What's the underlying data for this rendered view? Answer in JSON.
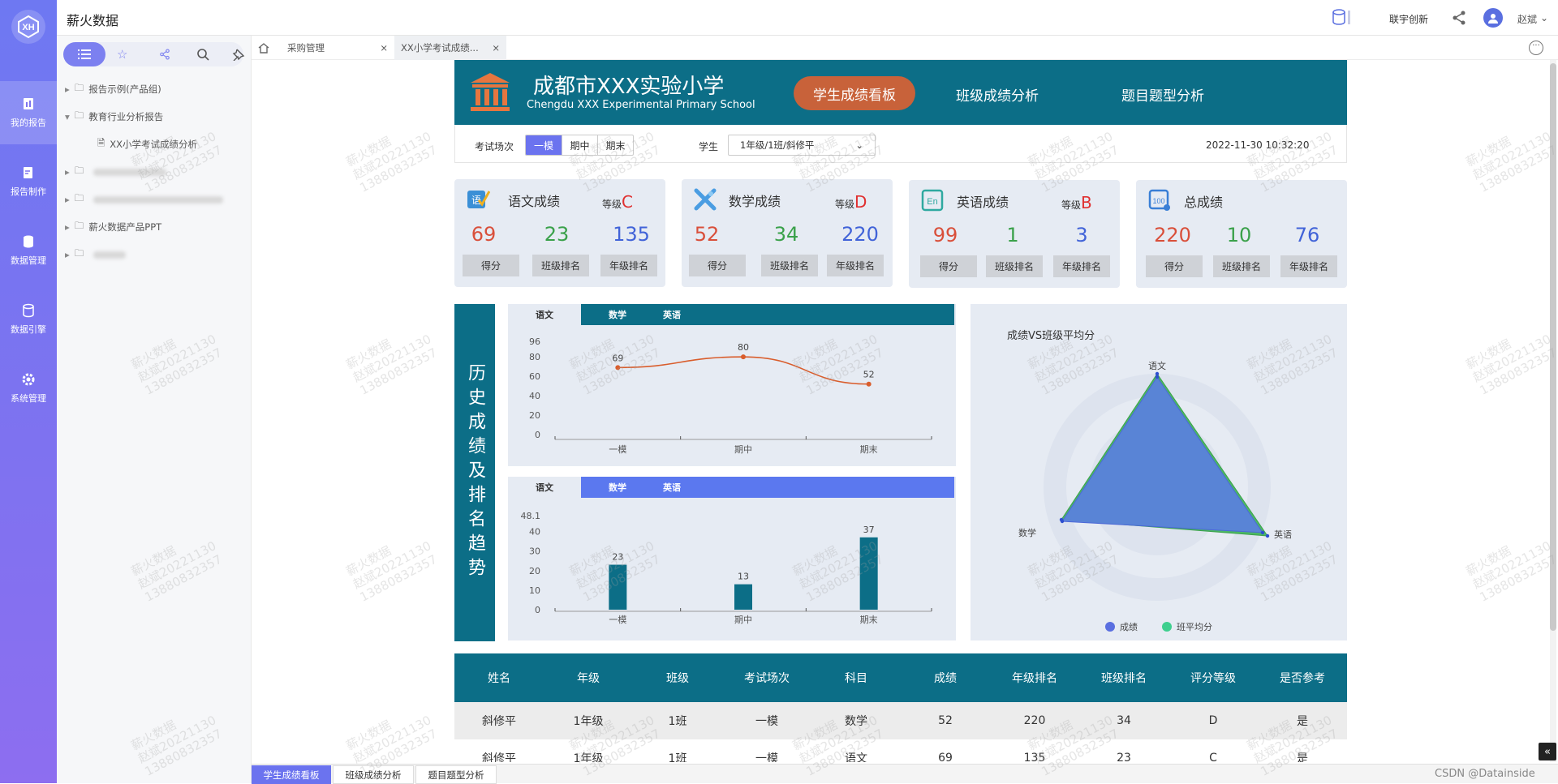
{
  "app": {
    "title": "薪火数据",
    "user": "赵斌",
    "brand_link": "联宇创新"
  },
  "leftnav": [
    {
      "label": "我的报告",
      "icon": "report-icon",
      "active": true
    },
    {
      "label": "报告制作",
      "icon": "edit-icon"
    },
    {
      "label": "数据管理",
      "icon": "database-icon"
    },
    {
      "label": "数据引擎",
      "icon": "engine-icon"
    },
    {
      "label": "系统管理",
      "icon": "gear-icon"
    }
  ],
  "tree": {
    "items": [
      {
        "label": "报告示例(产品组)"
      },
      {
        "label": "教育行业分析报告"
      },
      {
        "label": "XX小学考试成绩分析"
      },
      {
        "label": ""
      },
      {
        "label": ""
      },
      {
        "label": "薪火数据产品PPT"
      },
      {
        "label": ""
      }
    ]
  },
  "tabs": [
    {
      "label": "采购管理"
    },
    {
      "label": "XX小学考试成绩..."
    }
  ],
  "header": {
    "school_cn": "成都市XXX实验小学",
    "school_en": "Chengdu XXX Experimental Primary School",
    "nav": [
      "学生成绩看板",
      "班级成绩分析",
      "题目题型分析"
    ]
  },
  "filters": {
    "exam_label": "考试场次",
    "exam_options": [
      "一模",
      "期中",
      "期末"
    ],
    "student_label": "学生",
    "student_value": "1年级/1班/斜修平",
    "datetime": "2022-11-30 10:32:20"
  },
  "cards": [
    {
      "title": "语文成绩",
      "level_label": "等级",
      "level": "C",
      "score": "69",
      "class_rank": "23",
      "grade_rank": "135",
      "icon": "chinese-icon"
    },
    {
      "title": "数学成绩",
      "level_label": "等级",
      "level": "D",
      "score": "52",
      "class_rank": "34",
      "grade_rank": "220",
      "icon": "math-icon"
    },
    {
      "title": "英语成绩",
      "level_label": "等级",
      "level": "B",
      "score": "99",
      "class_rank": "1",
      "grade_rank": "3",
      "icon": "english-icon"
    },
    {
      "title": "总成绩",
      "level_label": "",
      "level": "",
      "score": "220",
      "class_rank": "10",
      "grade_rank": "76",
      "icon": "total-icon"
    }
  ],
  "card_labels": [
    "得分",
    "班级排名",
    "年级排名"
  ],
  "trend_title": "历史成绩及排名趋势",
  "subject_tabs": [
    "语文",
    "数学",
    "英语"
  ],
  "radar_title": "成绩VS班级平均分",
  "colors": {
    "primary": "#0c6e87",
    "accent": "#c8623a",
    "score": "#5a6fe0",
    "avg": "#4cb865",
    "red": "#d94f3a",
    "green": "#3aa14a",
    "blue": "#4163d8"
  },
  "chart_data": [
    {
      "type": "line",
      "x": [
        "一模",
        "期中",
        "期末"
      ],
      "values": [
        69,
        80,
        52
      ],
      "yticks": [
        0,
        20,
        40,
        60,
        80,
        96
      ],
      "ylim": [
        0,
        96
      ]
    },
    {
      "type": "bar",
      "categories": [
        "一模",
        "期中",
        "期末"
      ],
      "values": [
        23,
        13,
        37
      ],
      "yticks": [
        0,
        10,
        20,
        30,
        40,
        48.1
      ],
      "ylim": [
        0,
        48.1
      ]
    },
    {
      "type": "radar",
      "axes": [
        "语文",
        "数学",
        "英语"
      ],
      "legend": [
        "成绩",
        "班平均分"
      ],
      "legend_position": "bottom"
    }
  ],
  "table": {
    "headers": [
      "姓名",
      "年级",
      "班级",
      "考试场次",
      "科目",
      "成绩",
      "年级排名",
      "班级排名",
      "评分等级",
      "是否参考"
    ],
    "rows": [
      [
        "斜修平",
        "1年级",
        "1班",
        "一模",
        "数学",
        "52",
        "220",
        "34",
        "D",
        "是"
      ],
      [
        "斜修平",
        "1年级",
        "1班",
        "一模",
        "语文",
        "69",
        "135",
        "23",
        "C",
        "是"
      ]
    ]
  },
  "bottom_tabs": [
    "学生成绩看板",
    "班级成绩分析",
    "题目题型分析"
  ],
  "footer_credit": "CSDN @Datainside",
  "watermark": [
    "薪火数据",
    "赵斌20221130",
    "13880832357"
  ]
}
